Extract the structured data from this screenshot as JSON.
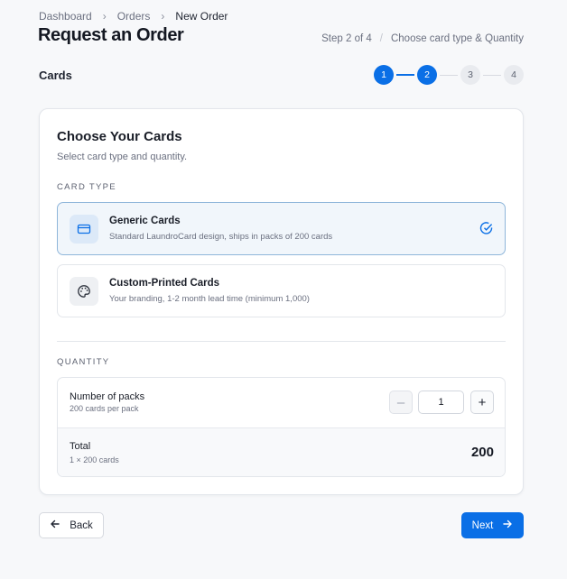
{
  "breadcrumb": [
    "Dashboard",
    "Orders",
    "New Order"
  ],
  "page_title": "Request an Order",
  "step_info": {
    "step": "Step 2 of 4",
    "description": "Choose card type & Quantity"
  },
  "section_label": "Cards",
  "stepper": {
    "steps": [
      "1",
      "2",
      "3",
      "4"
    ],
    "current": 2
  },
  "card": {
    "title": "Choose Your Cards",
    "subtitle": "Select card type and quantity.",
    "card_type_label": "CARD TYPE",
    "options": [
      {
        "name": "Generic Cards",
        "description": "Standard LaundroCard design, ships in packs of 200 cards",
        "icon": "credit-card-icon",
        "selected": true
      },
      {
        "name": "Custom-Printed Cards",
        "description": "Your branding, 1-2 month lead time (minimum 1,000)",
        "icon": "palette-icon",
        "selected": false
      }
    ],
    "quantity_label": "QUANTITY",
    "quantity": {
      "title": "Number of packs",
      "subtitle": "200 cards per pack",
      "value": "1",
      "decrement": "–",
      "increment": "+"
    },
    "total": {
      "title": "Total",
      "subtitle": "1 × 200 cards",
      "value": "200"
    }
  },
  "actions": {
    "back": "Back",
    "next": "Next"
  },
  "colors": {
    "accent": "#0a6fe6",
    "selected_border": "#8fb6da",
    "selected_bg": "#f1f6fb"
  }
}
